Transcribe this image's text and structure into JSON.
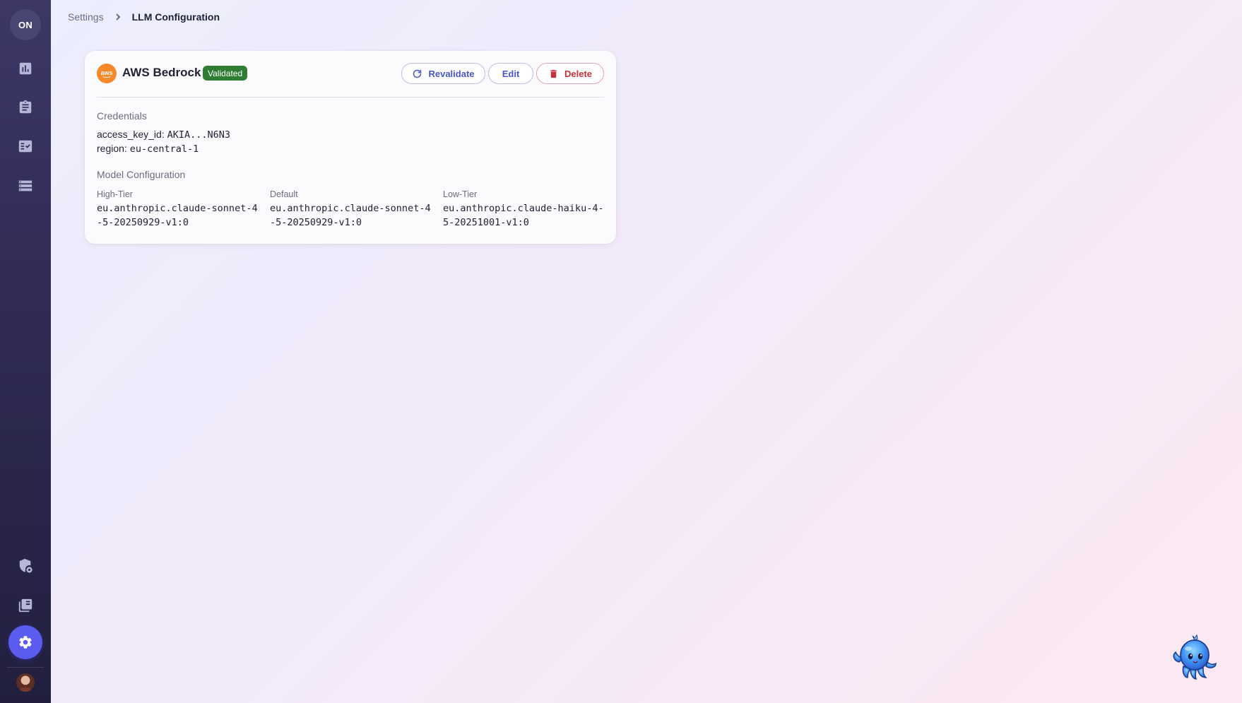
{
  "sidebar": {
    "logo_text": "ON",
    "items": [
      {
        "name": "analytics",
        "icon": "bar-chart-icon"
      },
      {
        "name": "assignments",
        "icon": "clipboard-icon"
      },
      {
        "name": "tasks",
        "icon": "checklist-icon"
      },
      {
        "name": "lists",
        "icon": "list-icon"
      },
      {
        "name": "security",
        "icon": "shield-lock-icon"
      },
      {
        "name": "library",
        "icon": "library-icon"
      },
      {
        "name": "settings",
        "icon": "gear-icon",
        "active": true
      }
    ],
    "active_color": "#5b5bef"
  },
  "breadcrumb": {
    "parent": "Settings",
    "current": "LLM Configuration"
  },
  "provider": {
    "logo_text": "aws",
    "name": "AWS Bedrock",
    "status": "Validated",
    "status_color": "#2e7d32",
    "actions": {
      "revalidate": "Revalidate",
      "edit": "Edit",
      "delete": "Delete"
    },
    "credentials": {
      "title": "Credentials",
      "access_key_label": "access_key_id: ",
      "access_key_value": "AKIA...N6N3",
      "region_label": "region: ",
      "region_value": "eu-central-1"
    },
    "model_config": {
      "title": "Model Configuration",
      "columns": [
        {
          "label": "High-Tier",
          "value": "eu.anthropic.claude-sonnet-4-5-20250929-v1:0"
        },
        {
          "label": "Default",
          "value": "eu.anthropic.claude-sonnet-4-5-20250929-v1:0"
        },
        {
          "label": "Low-Tier",
          "value": "eu.anthropic.claude-haiku-4-5-20251001-v1:0"
        }
      ]
    }
  }
}
